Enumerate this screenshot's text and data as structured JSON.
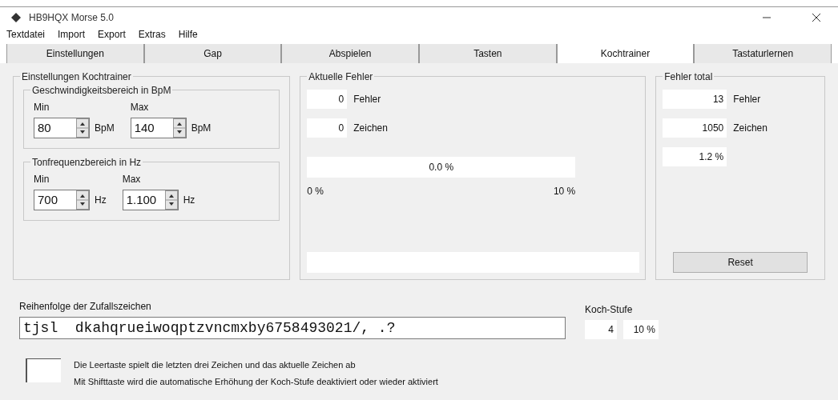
{
  "window": {
    "title": "HB9HQX Morse 5.0"
  },
  "menu": [
    "Textdatei",
    "Import",
    "Export",
    "Extras",
    "Hilfe"
  ],
  "tabs": [
    {
      "label": "Einstellungen",
      "selected": false
    },
    {
      "label": "Gap",
      "selected": false
    },
    {
      "label": "Abspielen",
      "selected": false
    },
    {
      "label": "Tasten",
      "selected": false
    },
    {
      "label": "Kochtrainer",
      "selected": true
    },
    {
      "label": "Tastaturlernen",
      "selected": false
    }
  ],
  "settings": {
    "title": "Einstellungen Kochtrainer",
    "groups": [
      {
        "title": "Geschwindigkeitsbereich in BpM",
        "min_label": "Min",
        "max_label": "Max",
        "min": "80",
        "max": "140",
        "min_unit": "BpM",
        "max_unit": "BpM"
      },
      {
        "title": "Tonfrequenzbereich in Hz",
        "min_label": "Min",
        "max_label": "Max",
        "min": "700",
        "max": "1.100",
        "min_unit": "Hz",
        "max_unit": "Hz"
      }
    ]
  },
  "current_errors": {
    "title": "Aktuelle Fehler",
    "errors": "0",
    "errors_label": "Fehler",
    "chars": "0",
    "chars_label": "Zeichen",
    "bar_text": "0.0 %",
    "scale_min": "0 %",
    "scale_max": "10 %"
  },
  "total_errors": {
    "title": "Fehler total",
    "errors": "13",
    "errors_label": "Fehler",
    "chars": "1050",
    "chars_label": "Zeichen",
    "percent": "1.2 %",
    "reset": "Reset"
  },
  "sequence": {
    "label": "Reihenfolge der Zufallszeichen",
    "value": "tjsl  dkahqrueiwoqptzvncmxby6758493021/, .?",
    "koch_label": "Koch-Stufe",
    "koch_level": "4",
    "koch_percent": "10 %"
  },
  "hints": [
    "Die Leertaste spielt die letzten drei Zeichen und das aktuelle Zeichen ab",
    "Mit Shifttaste wird die automatische Erhöhung der Koch-Stufe deaktiviert oder wieder aktiviert"
  ]
}
